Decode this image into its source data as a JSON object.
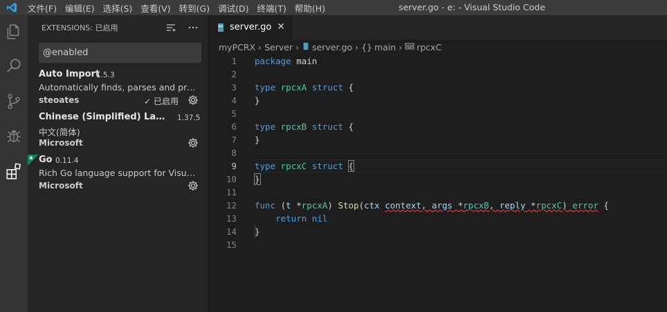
{
  "titlebar": {
    "menu": [
      "文件(F)",
      "编辑(E)",
      "选择(S)",
      "查看(V)",
      "转到(G)",
      "调试(D)",
      "终端(T)",
      "帮助(H)"
    ],
    "window_title": "server.go - e: - Visual Studio Code"
  },
  "activity_bar": {
    "items": [
      "explorer-icon",
      "search-icon",
      "source-control-icon",
      "debug-icon",
      "extensions-icon"
    ]
  },
  "sidebar": {
    "header": "EXTENSIONS: 已启用",
    "search_value": "@enabled",
    "extensions": [
      {
        "name": "Auto Import",
        "version": "1.5.3",
        "description": "Automatically finds, parses and provides code actions and code completion for all available imports.",
        "publisher": "steoates",
        "status": "✓ 已启用"
      },
      {
        "name": "Chinese (Simplified) Language Pack for Visual Studio Code",
        "version": "1.37.5",
        "description": "中文(简体)",
        "publisher": "Microsoft"
      },
      {
        "name": "Go",
        "version": "0.11.4",
        "description": "Rich Go language support for Visual Studio Code",
        "publisher": "Microsoft"
      }
    ]
  },
  "editor": {
    "tab_label": "server.go",
    "breadcrumbs": [
      "myPCRX",
      "Server",
      "server.go",
      "main",
      "rpcxC"
    ],
    "active_line": 9,
    "lines": [
      "package main",
      "",
      "type rpcxA struct {",
      "}",
      "",
      "type rpcxB struct {",
      "}",
      "",
      "type rpcxC struct {",
      "}",
      "",
      "func (t *rpcxA) Stop(ctx context, args *rpcxB, reply *rpcxC) error {",
      "    return nil",
      "}",
      ""
    ]
  },
  "colors": {
    "keyword": "#569cd6",
    "type": "#4ec9b0",
    "function": "#dcdcaa",
    "variable": "#9cdcfe",
    "accent": "#007acc"
  }
}
